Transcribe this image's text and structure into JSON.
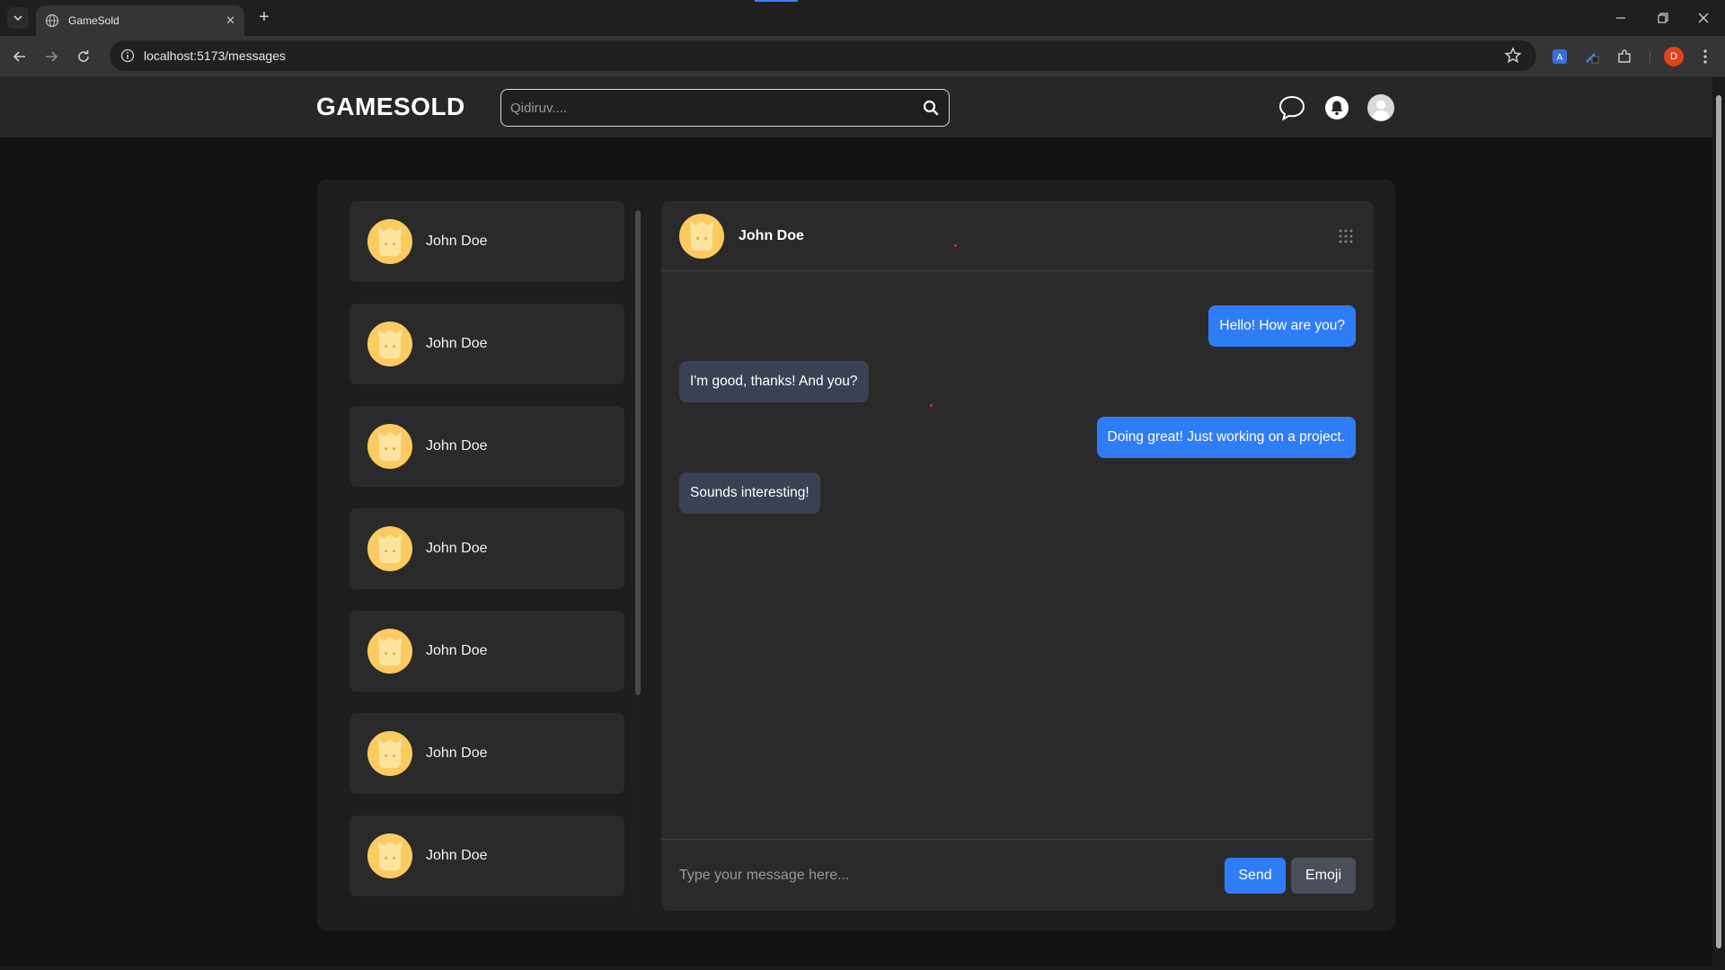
{
  "browser": {
    "tab_title": "GameSold",
    "url": "localhost:5173/messages",
    "profile_initial": "D"
  },
  "header": {
    "logo": "GAMESOLD",
    "search_placeholder": "Qidiruv...."
  },
  "contacts": [
    {
      "name": "John Doe"
    },
    {
      "name": "John Doe"
    },
    {
      "name": "John Doe"
    },
    {
      "name": "John Doe"
    },
    {
      "name": "John Doe"
    },
    {
      "name": "John Doe"
    },
    {
      "name": "John Doe"
    }
  ],
  "chat": {
    "contact_name": "John Doe",
    "messages": [
      {
        "text": "Hello! How are you?",
        "direction": "sent"
      },
      {
        "text": "I'm good, thanks! And you?",
        "direction": "received"
      },
      {
        "text": "Doing great! Just working on a project.",
        "direction": "sent"
      },
      {
        "text": "Sounds interesting!",
        "direction": "received"
      }
    ],
    "input_placeholder": "Type your message here...",
    "send_label": "Send",
    "emoji_label": "Emoji"
  },
  "colors": {
    "accent": "#2f7df6",
    "received_bubble": "#3a4152",
    "avatar": "#fbcb62"
  }
}
